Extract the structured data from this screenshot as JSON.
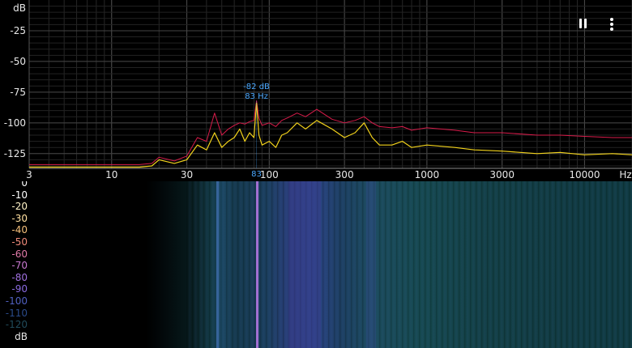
{
  "spectrum": {
    "y_unit": "dB",
    "y_ticks": [
      {
        "value": -25,
        "label": "-25"
      },
      {
        "value": -50,
        "label": "-50"
      },
      {
        "value": -75,
        "label": "-75"
      },
      {
        "value": -100,
        "label": "-100"
      },
      {
        "value": -125,
        "label": "-125"
      }
    ],
    "x_unit": "Hz",
    "x_ticks": [
      {
        "value": 3,
        "label": "3"
      },
      {
        "value": 10,
        "label": "10"
      },
      {
        "value": 30,
        "label": "30"
      },
      {
        "value": 100,
        "label": "100"
      },
      {
        "value": 300,
        "label": "300"
      },
      {
        "value": 1000,
        "label": "1000"
      },
      {
        "value": 3000,
        "label": "3000"
      },
      {
        "value": 10000,
        "label": "10000"
      }
    ],
    "x_range": [
      3,
      20000
    ],
    "y_range": [
      -137,
      0
    ],
    "peak": {
      "db_label": "-82 dB",
      "hz_label": "83 Hz",
      "cursor_label": "83",
      "hz": 83,
      "db": -82
    },
    "colors": {
      "current": "#f2d21b",
      "peak_hold": "#d81b4a",
      "grid": "#3a3a3a",
      "peak_text": "#4aa8ff"
    }
  },
  "controls": {
    "pause_icon": "pause-icon",
    "menu_icon": "more-vert-icon"
  },
  "spectrogram": {
    "scale": [
      {
        "label": "0",
        "color": "#ffffff"
      },
      {
        "label": "-10",
        "color": "#ffffff"
      },
      {
        "label": "-20",
        "color": "#fff3c8"
      },
      {
        "label": "-30",
        "color": "#ffe0a0"
      },
      {
        "label": "-40",
        "color": "#f6c07a"
      },
      {
        "label": "-50",
        "color": "#f08a7a"
      },
      {
        "label": "-60",
        "color": "#e07aa8"
      },
      {
        "label": "-70",
        "color": "#c878d0"
      },
      {
        "label": "-80",
        "color": "#a070e0"
      },
      {
        "label": "-90",
        "color": "#8a6ae0"
      },
      {
        "label": "-100",
        "color": "#5060c0"
      },
      {
        "label": "-110",
        "color": "#2a4a8a"
      },
      {
        "label": "-120",
        "color": "#204a5a"
      },
      {
        "label": "dB",
        "color": "#e8e8e8"
      }
    ],
    "cursor_hz": 83
  },
  "chart_data": {
    "type": "line",
    "title": "",
    "xlabel": "Hz",
    "ylabel": "dB",
    "xscale": "log",
    "xlim": [
      3,
      20000
    ],
    "ylim": [
      -137,
      0
    ],
    "grid": true,
    "series": [
      {
        "color": "#f2d21b",
        "x": [
          3,
          10,
          15,
          18,
          20,
          25,
          30,
          35,
          40,
          45,
          50,
          55,
          60,
          65,
          70,
          75,
          80,
          83,
          86,
          90,
          100,
          110,
          120,
          130,
          150,
          170,
          200,
          250,
          300,
          350,
          400,
          450,
          500,
          600,
          700,
          800,
          1000,
          1500,
          2000,
          3000,
          5000,
          7000,
          10000,
          15000,
          20000
        ],
        "y": [
          -136,
          -136,
          -136,
          -135,
          -130,
          -133,
          -130,
          -118,
          -122,
          -108,
          -120,
          -115,
          -112,
          -105,
          -115,
          -108,
          -112,
          -84,
          -110,
          -118,
          -115,
          -120,
          -110,
          -108,
          -100,
          -105,
          -98,
          -105,
          -112,
          -108,
          -100,
          -112,
          -118,
          -118,
          -115,
          -120,
          -118,
          -120,
          -122,
          -123,
          -125,
          -124,
          -126,
          -125,
          -126
        ]
      },
      {
        "color": "#d81b4a",
        "x": [
          3,
          10,
          15,
          18,
          20,
          25,
          30,
          35,
          40,
          45,
          50,
          55,
          60,
          65,
          70,
          75,
          80,
          83,
          86,
          90,
          100,
          110,
          120,
          130,
          150,
          170,
          200,
          250,
          300,
          350,
          400,
          450,
          500,
          600,
          700,
          800,
          1000,
          1500,
          2000,
          3000,
          5000,
          7000,
          10000,
          15000,
          20000
        ],
        "y": [
          -134,
          -134,
          -134,
          -133,
          -128,
          -131,
          -127,
          -112,
          -115,
          -92,
          -110,
          -105,
          -102,
          -100,
          -101,
          -99,
          -98,
          -82,
          -96,
          -102,
          -100,
          -103,
          -98,
          -96,
          -92,
          -95,
          -89,
          -97,
          -100,
          -98,
          -95,
          -100,
          -103,
          -104,
          -103,
          -106,
          -104,
          -106,
          -108,
          -108,
          -110,
          -110,
          -111,
          -112,
          -112
        ]
      }
    ]
  }
}
